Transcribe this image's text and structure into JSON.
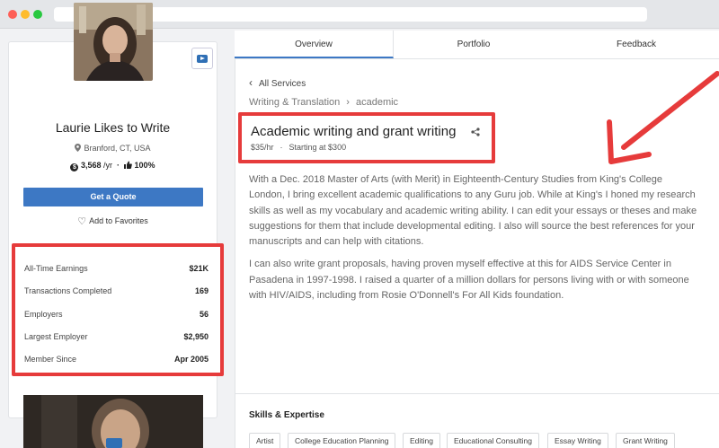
{
  "profile": {
    "name": "Laurie Likes to Write",
    "location": "Branford, CT, USA",
    "earnings_rate": "3,568",
    "rate_unit": "/yr",
    "rating": "100%",
    "quote_button": "Get a Quote",
    "favorites_label": "Add to Favorites",
    "stats": [
      {
        "label": "All-Time Earnings",
        "value": "$21K"
      },
      {
        "label": "Transactions Completed",
        "value": "169"
      },
      {
        "label": "Employers",
        "value": "56"
      },
      {
        "label": "Largest Employer",
        "value": "$2,950"
      },
      {
        "label": "Member Since",
        "value": "Apr 2005"
      }
    ]
  },
  "tabs": [
    {
      "label": "Overview",
      "active": true
    },
    {
      "label": "Portfolio",
      "active": false
    },
    {
      "label": "Feedback",
      "active": false
    }
  ],
  "service": {
    "back_label": "All Services",
    "breadcrumb": [
      "Writing & Translation",
      "academic"
    ],
    "title": "Academic writing and grant writing",
    "hourly_rate": "$35/hr",
    "starting_at": "Starting at $300",
    "description": [
      "With a Dec. 2018 Master of Arts (with Merit) in Eighteenth-Century Studies from King's College London, I bring excellent academic qualifications to any Guru job. While at King's I honed my research skills as well as my vocabulary and academic writing ability. I can edit your essays or theses and make suggestions for them that include developmental editing. I also will source the best references for your manuscripts and can help with citations.",
      "I can also write grant proposals, having proven myself effective at this for AIDS Service Center in Pasadena in 1997-1998. I raised a quarter of a million dollars for persons living with or with someone with HIV/AIDS, including from Rosie O'Donnell's For All Kids foundation."
    ]
  },
  "skills": {
    "title": "Skills & Expertise",
    "items": [
      "Artist",
      "College Education Planning",
      "Editing",
      "Educational Consulting",
      "Essay Writing",
      "Grant Writing"
    ]
  },
  "colors": {
    "accent": "#3d78c4",
    "highlight": "#e63b3b"
  },
  "icons": [
    "location-pin-icon",
    "coin-icon",
    "thumbs-up-icon",
    "heart-icon",
    "video-icon",
    "chevron-left-icon",
    "share-icon"
  ]
}
